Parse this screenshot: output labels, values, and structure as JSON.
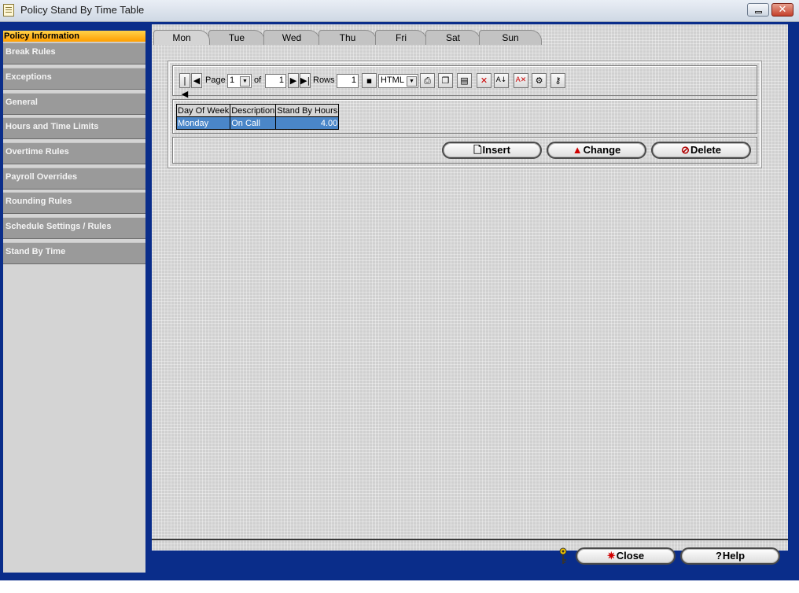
{
  "window": {
    "title": "Policy Stand By Time Table",
    "minimize_label": "–",
    "close_label": "✕"
  },
  "sidebar": {
    "items": [
      {
        "label": "Policy Information",
        "active": true
      },
      {
        "label": "Break Rules"
      },
      {
        "label": "Exceptions"
      },
      {
        "label": "General"
      },
      {
        "label": "Hours and Time Limits"
      },
      {
        "label": "Overtime Rules"
      },
      {
        "label": "Payroll Overrides"
      },
      {
        "label": "Rounding Rules"
      },
      {
        "label": "Schedule Settings / Rules"
      },
      {
        "label": "Stand By Time"
      }
    ]
  },
  "tabs": [
    "Mon",
    "Tue",
    "Wed",
    "Thu",
    "Fri",
    "Sat",
    "Sun"
  ],
  "active_tab": "Mon",
  "toolbar": {
    "page_label": "Page",
    "page_value": "1",
    "of_label": "of",
    "total_pages": "1",
    "rows_label": "Rows",
    "rows_value": "1",
    "format_value": "HTML"
  },
  "table": {
    "headers": [
      "Day Of Week",
      "Description",
      "Stand By Hours"
    ],
    "rows": [
      [
        "Monday",
        "On Call",
        "4.00"
      ]
    ]
  },
  "actions": {
    "insert": "Insert",
    "change": "Change",
    "delete": "Delete"
  },
  "footer": {
    "close": "Close",
    "help": "Help"
  },
  "colors": {
    "frame": "#0a2d8a",
    "selected_row": "#4a86c8",
    "active_side": "#ffb000"
  }
}
